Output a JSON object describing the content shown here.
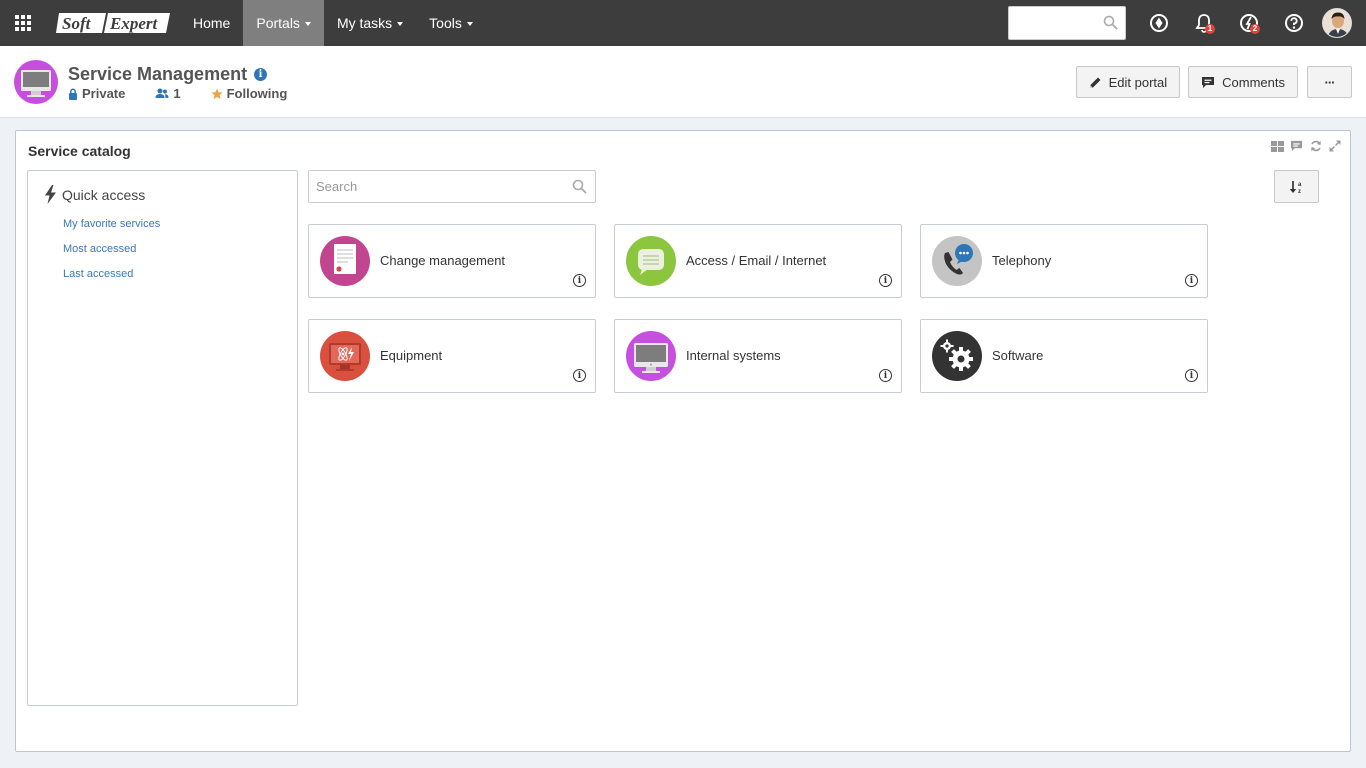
{
  "topbar": {
    "logo_left": "Soft",
    "logo_right": "Expert",
    "nav": [
      {
        "label": "Home",
        "dropdown": false
      },
      {
        "label": "Portals",
        "dropdown": true,
        "active": true
      },
      {
        "label": "My tasks",
        "dropdown": true
      },
      {
        "label": "Tools",
        "dropdown": true
      }
    ],
    "search_value": "",
    "notifications_count": "1",
    "tasks_count": "2"
  },
  "portal": {
    "title": "Service Management",
    "privacy": "Private",
    "members": "1",
    "following": "Following",
    "edit_label": "Edit portal",
    "comments_label": "Comments",
    "more_label": "···"
  },
  "catalog": {
    "title": "Service catalog",
    "search_placeholder": "Search",
    "quick_access": {
      "title": "Quick access",
      "links": [
        "My favorite services",
        "Most accessed",
        "Last accessed"
      ]
    },
    "services": [
      {
        "label": "Change management",
        "icon": "document-icon",
        "color": "#c2458f"
      },
      {
        "label": "Access / Email / Internet",
        "icon": "chat-bubble-icon",
        "color": "#8cc63f"
      },
      {
        "label": "Telephony",
        "icon": "phone-icon",
        "color": "#c4c4c4"
      },
      {
        "label": "Equipment",
        "icon": "monitor-atom-icon",
        "color": "#d9503f"
      },
      {
        "label": "Internal systems",
        "icon": "monitor-icon",
        "color": "#c64fe0"
      },
      {
        "label": "Software",
        "icon": "gears-icon",
        "color": "#333333"
      }
    ]
  },
  "colors": {
    "topbar": "#3d3d3d",
    "link": "#3a78b9",
    "accent_info": "#2f76b8",
    "badge": "#e2433d"
  }
}
